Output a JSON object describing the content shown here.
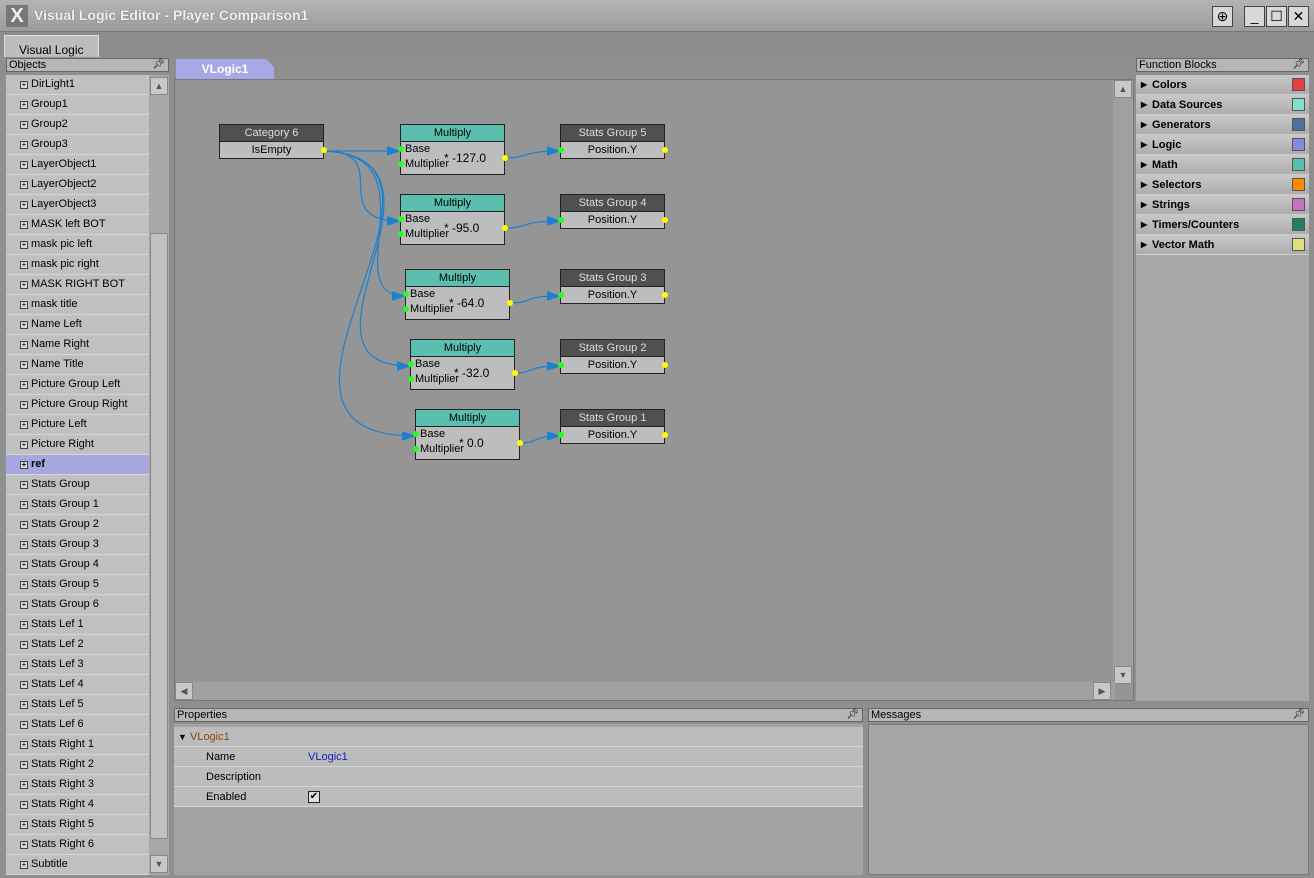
{
  "window": {
    "title": "Visual Logic Editor - Player Comparison1",
    "app_icon": "X",
    "buttons": [
      "⊕",
      "_",
      "☐",
      "✕"
    ]
  },
  "tabs": {
    "main": "Visual Logic",
    "canvas": "VLogic1"
  },
  "objects": {
    "header": "Objects",
    "selected": "ref",
    "items": [
      "DirLight1",
      "Group1",
      "Group2",
      "Group3",
      "LayerObject1",
      "LayerObject2",
      "LayerObject3",
      "MASK left  BOT",
      "mask pic left",
      "mask pic right",
      "MASK RIGHT BOT",
      "mask title",
      "Name Left",
      "Name Right",
      "Name Title",
      "Picture Group Left",
      "Picture Group Right",
      "Picture Left",
      "Picture Right",
      "ref",
      "Stats Group",
      "Stats Group 1",
      "Stats Group 2",
      "Stats Group 3",
      "Stats Group 4",
      "Stats Group 5",
      "Stats Group 6",
      "Stats Lef 1",
      "Stats Lef 2",
      "Stats Lef 3",
      "Stats Lef 4",
      "Stats Lef 5",
      "Stats Lef 6",
      "Stats Right 1",
      "Stats Right 2",
      "Stats Right 3",
      "Stats Right 4",
      "Stats Right 5",
      "Stats Right 6",
      "Subtitle"
    ]
  },
  "graph": {
    "source": {
      "title": "Category 6",
      "output": "IsEmpty"
    },
    "multiply": [
      {
        "title": "Multiply",
        "in1": "Base",
        "in2": "Multiplier",
        "value": "* -127.0"
      },
      {
        "title": "Multiply",
        "in1": "Base",
        "in2": "Multiplier",
        "value": "* -95.0"
      },
      {
        "title": "Multiply",
        "in1": "Base",
        "in2": "Multiplier",
        "value": "* -64.0"
      },
      {
        "title": "Multiply",
        "in1": "Base",
        "in2": "Multiplier",
        "value": "* -32.0"
      },
      {
        "title": "Multiply",
        "in1": "Base",
        "in2": "Multiplier",
        "value": "* 0.0"
      }
    ],
    "targets": [
      {
        "title": "Stats Group 5",
        "input": "Position.Y"
      },
      {
        "title": "Stats Group 4",
        "input": "Position.Y"
      },
      {
        "title": "Stats Group 3",
        "input": "Position.Y"
      },
      {
        "title": "Stats Group 2",
        "input": "Position.Y"
      },
      {
        "title": "Stats Group 1",
        "input": "Position.Y"
      }
    ]
  },
  "properties": {
    "header": "Properties",
    "object": "VLogic1",
    "rows": [
      {
        "label": "Name",
        "value": "VLogic1"
      },
      {
        "label": "Description",
        "value": ""
      },
      {
        "label": "Enabled",
        "checked": true
      }
    ]
  },
  "messages": {
    "header": "Messages"
  },
  "function_blocks": {
    "header": "Function Blocks",
    "items": [
      {
        "label": "Colors",
        "color": "#e04040"
      },
      {
        "label": "Data Sources",
        "color": "#80e0d0"
      },
      {
        "label": "Generators",
        "color": "#4f6f9f"
      },
      {
        "label": "Logic",
        "color": "#8888e0"
      },
      {
        "label": "Math",
        "color": "#5bbfb0"
      },
      {
        "label": "Selectors",
        "color": "#ff8800"
      },
      {
        "label": "Strings",
        "color": "#cc70c0"
      },
      {
        "label": "Timers/Counters",
        "color": "#208060"
      },
      {
        "label": "Vector Math",
        "color": "#e0e080"
      }
    ]
  }
}
